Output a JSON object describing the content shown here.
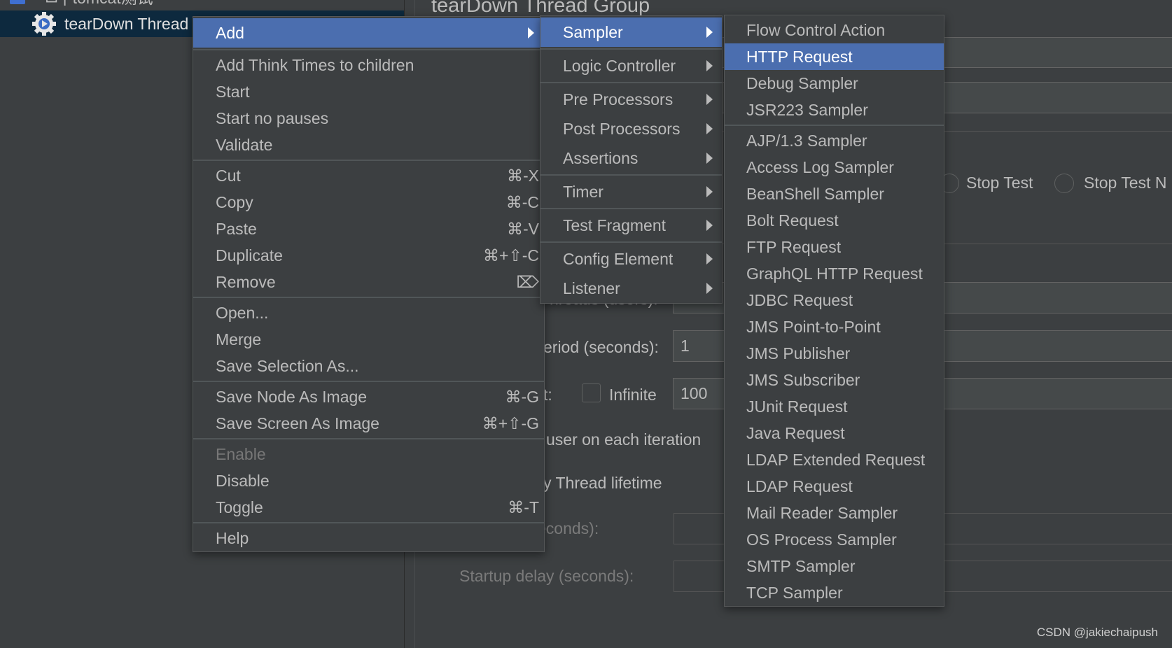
{
  "tree": {
    "parent_label": "tomcat测试",
    "selected_label": "tearDown Thread Group",
    "selected_visible": "tearDown Thread"
  },
  "form": {
    "title": "tearDown Thread Group",
    "stop_test": "Stop Test",
    "stop_test_now": "Stop Test N",
    "threads_label": "hreads (users):",
    "ramp_label": "eriod (seconds):",
    "ramp_value": "1",
    "loop_label": "t:",
    "infinite_label": "Infinite",
    "loop_value": "100",
    "same_user_label": "user on each iteration",
    "lifetime_label": "y Thread lifetime",
    "duration_label": "econds):",
    "startup_label": "Startup delay (seconds):"
  },
  "context_menu": {
    "groups": [
      [
        {
          "label": "Add",
          "submenu": true,
          "highlighted": true
        }
      ],
      [
        {
          "label": "Add Think Times to children"
        },
        {
          "label": "Start"
        },
        {
          "label": "Start no pauses"
        },
        {
          "label": "Validate"
        }
      ],
      [
        {
          "label": "Cut",
          "shortcut": "⌘-X"
        },
        {
          "label": "Copy",
          "shortcut": "⌘-C"
        },
        {
          "label": "Paste",
          "shortcut": "⌘-V"
        },
        {
          "label": "Duplicate",
          "shortcut": "⌘+⇧-C"
        },
        {
          "label": "Remove",
          "shortcut": "⌦"
        }
      ],
      [
        {
          "label": "Open..."
        },
        {
          "label": "Merge"
        },
        {
          "label": "Save Selection As..."
        }
      ],
      [
        {
          "label": "Save Node As Image",
          "shortcut": "⌘-G"
        },
        {
          "label": "Save Screen As Image",
          "shortcut": "⌘+⇧-G"
        }
      ],
      [
        {
          "label": "Enable",
          "disabled": true
        },
        {
          "label": "Disable"
        },
        {
          "label": "Toggle",
          "shortcut": "⌘-T"
        }
      ],
      [
        {
          "label": "Help"
        }
      ]
    ]
  },
  "add_menu": {
    "groups": [
      [
        {
          "label": "Sampler",
          "submenu": true,
          "highlighted": true
        }
      ],
      [
        {
          "label": "Logic Controller",
          "submenu": true
        }
      ],
      [
        {
          "label": "Pre Processors",
          "submenu": true
        },
        {
          "label": "Post Processors",
          "submenu": true
        },
        {
          "label": "Assertions",
          "submenu": true
        }
      ],
      [
        {
          "label": "Timer",
          "submenu": true
        }
      ],
      [
        {
          "label": "Test Fragment",
          "submenu": true
        }
      ],
      [
        {
          "label": "Config Element",
          "submenu": true
        },
        {
          "label": "Listener",
          "submenu": true
        }
      ]
    ]
  },
  "sampler_menu": {
    "groups": [
      [
        {
          "label": "Flow Control Action"
        },
        {
          "label": "HTTP Request",
          "highlighted": true
        },
        {
          "label": "Debug Sampler"
        },
        {
          "label": "JSR223 Sampler"
        }
      ],
      [
        {
          "label": "AJP/1.3 Sampler"
        },
        {
          "label": "Access Log Sampler"
        },
        {
          "label": "BeanShell Sampler"
        },
        {
          "label": "Bolt Request"
        },
        {
          "label": "FTP Request"
        },
        {
          "label": "GraphQL HTTP Request"
        },
        {
          "label": "JDBC Request"
        },
        {
          "label": "JMS Point-to-Point"
        },
        {
          "label": "JMS Publisher"
        },
        {
          "label": "JMS Subscriber"
        },
        {
          "label": "JUnit Request"
        },
        {
          "label": "Java Request"
        },
        {
          "label": "LDAP Extended Request"
        },
        {
          "label": "LDAP Request"
        },
        {
          "label": "Mail Reader Sampler"
        },
        {
          "label": "OS Process Sampler"
        },
        {
          "label": "SMTP Sampler"
        },
        {
          "label": "TCP Sampler"
        }
      ]
    ]
  },
  "watermark": "CSDN @jakiechaipush",
  "colors": {
    "highlight": "#4b6eaf",
    "background": "#3c3f41",
    "tree_selection": "#0d293e",
    "text": "#bbbbbb"
  }
}
